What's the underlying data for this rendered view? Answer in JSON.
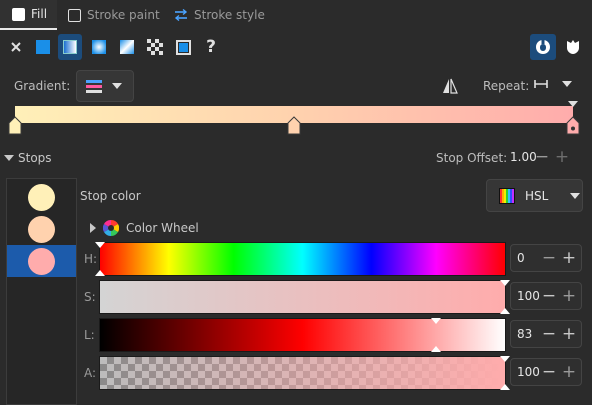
{
  "tabs": [
    {
      "label": "Fill",
      "checked": true
    },
    {
      "label": "Stroke paint",
      "checked": false
    },
    {
      "label": "Stroke style"
    }
  ],
  "mode_toolbar": {
    "items": [
      "no-paint-icon",
      "flat-color-icon",
      "linear-gradient-icon",
      "radial-gradient-icon",
      "mesh-gradient-icon",
      "pattern-icon",
      "swatch-icon",
      "unset-paint-icon"
    ],
    "active": "linear-gradient-icon",
    "unset_label": "?",
    "fill_rule_icons": [
      "fill-rule-evenodd-icon",
      "fill-rule-nonzero-icon"
    ]
  },
  "gradient": {
    "label": "Gradient:",
    "repeat_label": "Repeat:",
    "stops_colors": [
      "#fff0b8",
      "#ffd2ae",
      "#ffacac"
    ]
  },
  "stops": {
    "header": "Stops",
    "offset_label": "Stop Offset:",
    "offset_value": "1.00",
    "items": [
      {
        "color": "#fff0b8"
      },
      {
        "color": "#ffd2ae"
      },
      {
        "color": "#ffacac",
        "selected": true
      }
    ]
  },
  "stop_color": {
    "label": "Stop color",
    "model": "HSL",
    "wheel_label": "Color Wheel"
  },
  "channels": [
    {
      "label": "H:",
      "value": "0",
      "level": 0.0
    },
    {
      "label": "S:",
      "value": "100",
      "level": 1.0
    },
    {
      "label": "L:",
      "value": "83",
      "level": 0.83
    },
    {
      "label": "A:",
      "value": "100",
      "level": 1.0
    }
  ],
  "colors": {
    "accent": "#1c5bab",
    "active_button": "#1c4c7c",
    "background": "#2b2b2b"
  }
}
